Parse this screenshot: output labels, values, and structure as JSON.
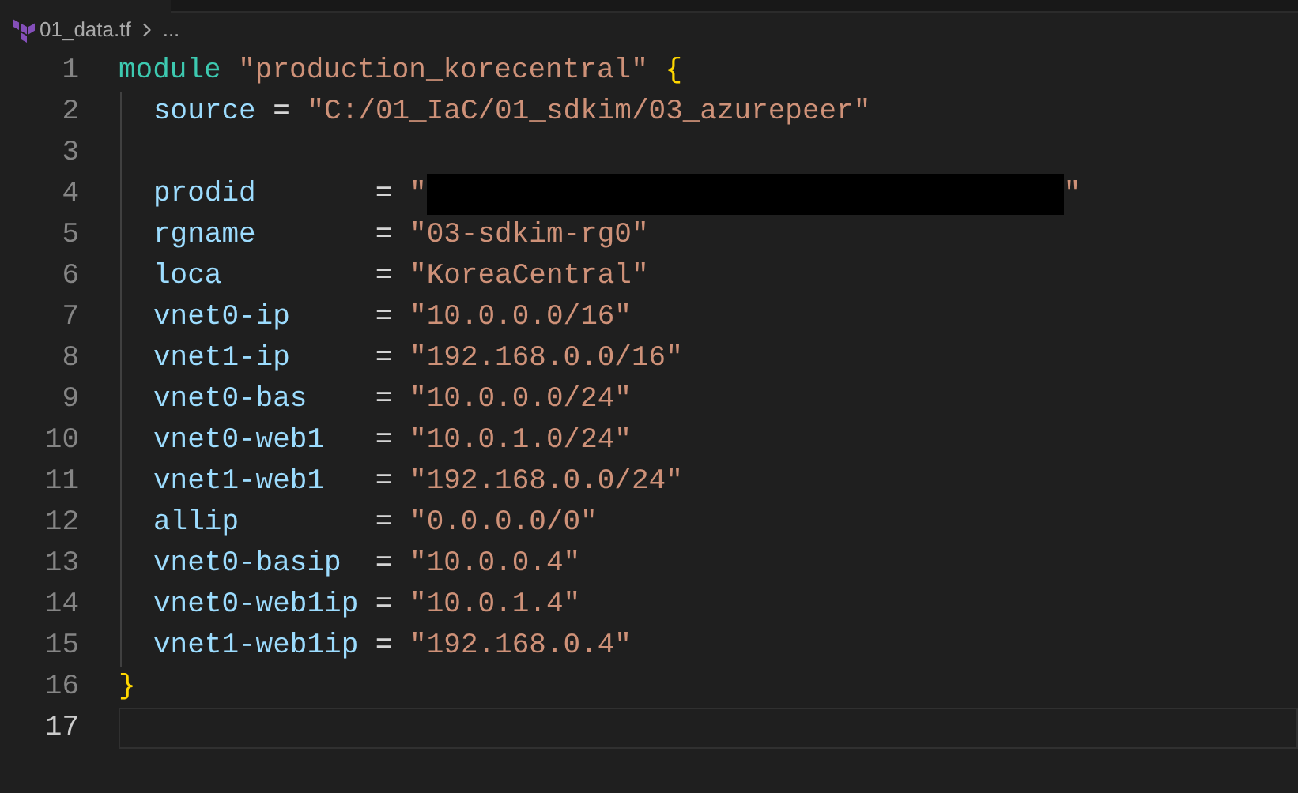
{
  "breadcrumb": {
    "file": "01_data.tf",
    "rest": "..."
  },
  "lines": [
    {
      "number": "1",
      "current": false,
      "kind": "open",
      "keyword": "module",
      "name": "\"production_korecentral\"",
      "brace": "{"
    },
    {
      "number": "2",
      "current": false,
      "kind": "assign",
      "key": "source",
      "op": "=",
      "value": "\"C:/01_IaC/01_sdkim/03_azurepeer\""
    },
    {
      "number": "3",
      "current": false,
      "kind": "blank"
    },
    {
      "number": "4",
      "current": false,
      "kind": "assign",
      "key": "prodid",
      "op": "=",
      "value": "\"",
      "redacted": true,
      "value_end": "\""
    },
    {
      "number": "5",
      "current": false,
      "kind": "assign",
      "key": "rgname",
      "op": "=",
      "value": "\"03-sdkim-rg0\""
    },
    {
      "number": "6",
      "current": false,
      "kind": "assign",
      "key": "loca",
      "op": "=",
      "value": "\"KoreaCentral\""
    },
    {
      "number": "7",
      "current": false,
      "kind": "assign",
      "key": "vnet0-ip",
      "op": "=",
      "value": "\"10.0.0.0/16\""
    },
    {
      "number": "8",
      "current": false,
      "kind": "assign",
      "key": "vnet1-ip",
      "op": "=",
      "value": "\"192.168.0.0/16\""
    },
    {
      "number": "9",
      "current": false,
      "kind": "assign",
      "key": "vnet0-bas",
      "op": "=",
      "value": "\"10.0.0.0/24\""
    },
    {
      "number": "10",
      "current": false,
      "kind": "assign",
      "key": "vnet0-web1",
      "op": "=",
      "value": "\"10.0.1.0/24\""
    },
    {
      "number": "11",
      "current": false,
      "kind": "assign",
      "key": "vnet1-web1",
      "op": "=",
      "value": "\"192.168.0.0/24\""
    },
    {
      "number": "12",
      "current": false,
      "kind": "assign",
      "key": "allip",
      "op": "=",
      "value": "\"0.0.0.0/0\""
    },
    {
      "number": "13",
      "current": false,
      "kind": "assign",
      "key": "vnet0-basip",
      "op": "=",
      "value": "\"10.0.0.4\""
    },
    {
      "number": "14",
      "current": false,
      "kind": "assign",
      "key": "vnet0-web1ip",
      "op": "=",
      "value": "\"10.0.1.4\""
    },
    {
      "number": "15",
      "current": false,
      "kind": "assign",
      "key": "vnet1-web1ip",
      "op": "=",
      "value": "\"192.168.0.4\""
    },
    {
      "number": "16",
      "current": false,
      "kind": "close",
      "brace": "}"
    },
    {
      "number": "17",
      "current": true,
      "kind": "blank"
    }
  ]
}
